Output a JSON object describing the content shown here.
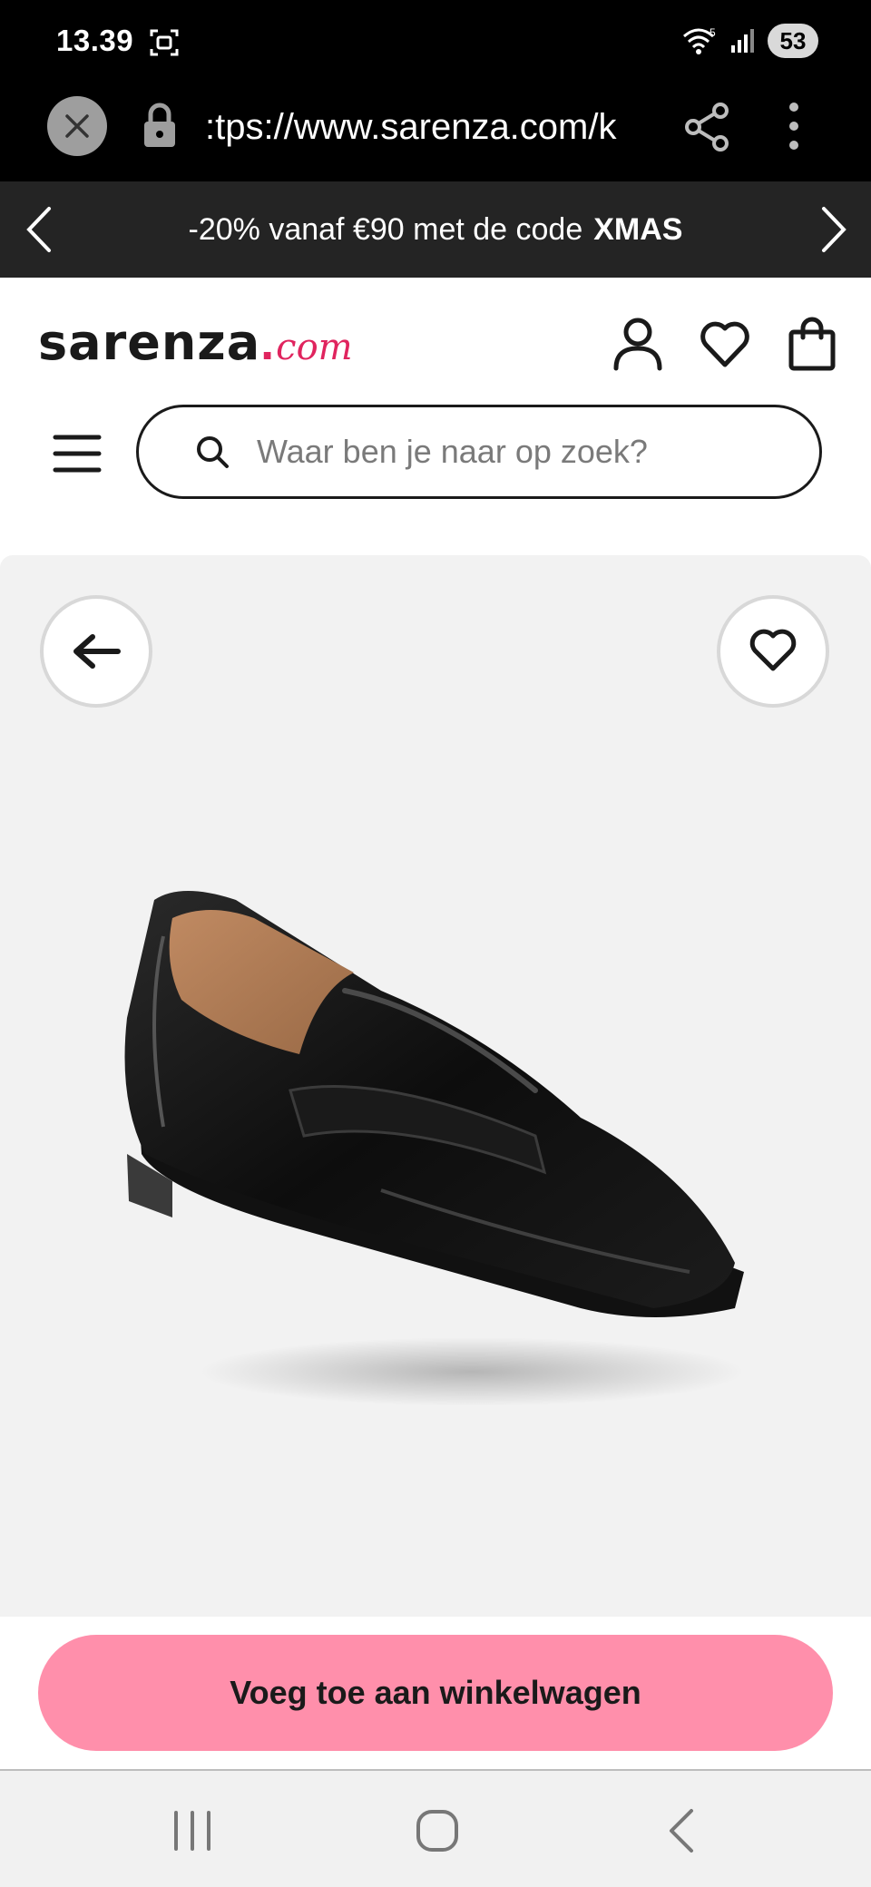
{
  "status_bar": {
    "time": "13.39",
    "battery": "53",
    "network_badge": "5"
  },
  "browser": {
    "url": ":tps://www.sarenza.com/k"
  },
  "promo": {
    "text": "-20% vanaf €90 met de code",
    "code": "XMAS"
  },
  "header": {
    "logo_main": "sarenza",
    "logo_dot": ".",
    "logo_suffix": "com"
  },
  "search": {
    "placeholder": "Waar ben je naar op zoek?"
  },
  "product": {
    "image_alt": "black patent loafer"
  },
  "cta": {
    "label": "Voeg toe aan winkelwagen"
  },
  "colors": {
    "accent_pink": "#ff8fab",
    "brand_pink": "#e0245e",
    "promo_bg": "#242424"
  }
}
